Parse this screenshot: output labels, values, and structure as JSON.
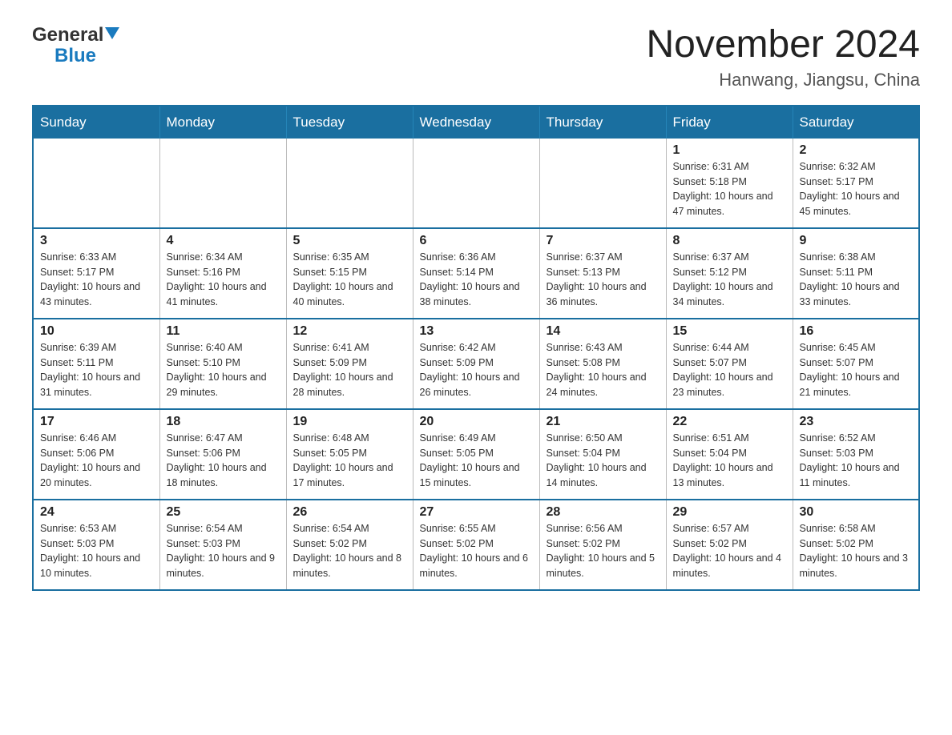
{
  "logo": {
    "general": "General",
    "blue": "Blue"
  },
  "header": {
    "month": "November 2024",
    "location": "Hanwang, Jiangsu, China"
  },
  "days_of_week": [
    "Sunday",
    "Monday",
    "Tuesday",
    "Wednesday",
    "Thursday",
    "Friday",
    "Saturday"
  ],
  "weeks": [
    [
      {
        "day": "",
        "info": ""
      },
      {
        "day": "",
        "info": ""
      },
      {
        "day": "",
        "info": ""
      },
      {
        "day": "",
        "info": ""
      },
      {
        "day": "",
        "info": ""
      },
      {
        "day": "1",
        "info": "Sunrise: 6:31 AM\nSunset: 5:18 PM\nDaylight: 10 hours and 47 minutes."
      },
      {
        "day": "2",
        "info": "Sunrise: 6:32 AM\nSunset: 5:17 PM\nDaylight: 10 hours and 45 minutes."
      }
    ],
    [
      {
        "day": "3",
        "info": "Sunrise: 6:33 AM\nSunset: 5:17 PM\nDaylight: 10 hours and 43 minutes."
      },
      {
        "day": "4",
        "info": "Sunrise: 6:34 AM\nSunset: 5:16 PM\nDaylight: 10 hours and 41 minutes."
      },
      {
        "day": "5",
        "info": "Sunrise: 6:35 AM\nSunset: 5:15 PM\nDaylight: 10 hours and 40 minutes."
      },
      {
        "day": "6",
        "info": "Sunrise: 6:36 AM\nSunset: 5:14 PM\nDaylight: 10 hours and 38 minutes."
      },
      {
        "day": "7",
        "info": "Sunrise: 6:37 AM\nSunset: 5:13 PM\nDaylight: 10 hours and 36 minutes."
      },
      {
        "day": "8",
        "info": "Sunrise: 6:37 AM\nSunset: 5:12 PM\nDaylight: 10 hours and 34 minutes."
      },
      {
        "day": "9",
        "info": "Sunrise: 6:38 AM\nSunset: 5:11 PM\nDaylight: 10 hours and 33 minutes."
      }
    ],
    [
      {
        "day": "10",
        "info": "Sunrise: 6:39 AM\nSunset: 5:11 PM\nDaylight: 10 hours and 31 minutes."
      },
      {
        "day": "11",
        "info": "Sunrise: 6:40 AM\nSunset: 5:10 PM\nDaylight: 10 hours and 29 minutes."
      },
      {
        "day": "12",
        "info": "Sunrise: 6:41 AM\nSunset: 5:09 PM\nDaylight: 10 hours and 28 minutes."
      },
      {
        "day": "13",
        "info": "Sunrise: 6:42 AM\nSunset: 5:09 PM\nDaylight: 10 hours and 26 minutes."
      },
      {
        "day": "14",
        "info": "Sunrise: 6:43 AM\nSunset: 5:08 PM\nDaylight: 10 hours and 24 minutes."
      },
      {
        "day": "15",
        "info": "Sunrise: 6:44 AM\nSunset: 5:07 PM\nDaylight: 10 hours and 23 minutes."
      },
      {
        "day": "16",
        "info": "Sunrise: 6:45 AM\nSunset: 5:07 PM\nDaylight: 10 hours and 21 minutes."
      }
    ],
    [
      {
        "day": "17",
        "info": "Sunrise: 6:46 AM\nSunset: 5:06 PM\nDaylight: 10 hours and 20 minutes."
      },
      {
        "day": "18",
        "info": "Sunrise: 6:47 AM\nSunset: 5:06 PM\nDaylight: 10 hours and 18 minutes."
      },
      {
        "day": "19",
        "info": "Sunrise: 6:48 AM\nSunset: 5:05 PM\nDaylight: 10 hours and 17 minutes."
      },
      {
        "day": "20",
        "info": "Sunrise: 6:49 AM\nSunset: 5:05 PM\nDaylight: 10 hours and 15 minutes."
      },
      {
        "day": "21",
        "info": "Sunrise: 6:50 AM\nSunset: 5:04 PM\nDaylight: 10 hours and 14 minutes."
      },
      {
        "day": "22",
        "info": "Sunrise: 6:51 AM\nSunset: 5:04 PM\nDaylight: 10 hours and 13 minutes."
      },
      {
        "day": "23",
        "info": "Sunrise: 6:52 AM\nSunset: 5:03 PM\nDaylight: 10 hours and 11 minutes."
      }
    ],
    [
      {
        "day": "24",
        "info": "Sunrise: 6:53 AM\nSunset: 5:03 PM\nDaylight: 10 hours and 10 minutes."
      },
      {
        "day": "25",
        "info": "Sunrise: 6:54 AM\nSunset: 5:03 PM\nDaylight: 10 hours and 9 minutes."
      },
      {
        "day": "26",
        "info": "Sunrise: 6:54 AM\nSunset: 5:02 PM\nDaylight: 10 hours and 8 minutes."
      },
      {
        "day": "27",
        "info": "Sunrise: 6:55 AM\nSunset: 5:02 PM\nDaylight: 10 hours and 6 minutes."
      },
      {
        "day": "28",
        "info": "Sunrise: 6:56 AM\nSunset: 5:02 PM\nDaylight: 10 hours and 5 minutes."
      },
      {
        "day": "29",
        "info": "Sunrise: 6:57 AM\nSunset: 5:02 PM\nDaylight: 10 hours and 4 minutes."
      },
      {
        "day": "30",
        "info": "Sunrise: 6:58 AM\nSunset: 5:02 PM\nDaylight: 10 hours and 3 minutes."
      }
    ]
  ]
}
